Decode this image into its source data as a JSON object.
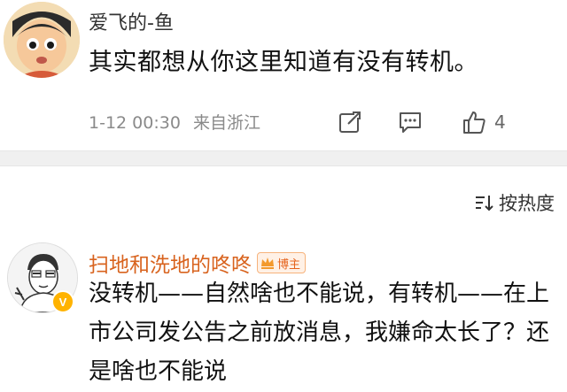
{
  "comment1": {
    "username": "爱飞的-鱼",
    "text": "其实都想从你这里知道有没有转机。",
    "timestamp": "1-12 00:30",
    "source": "来自浙江",
    "like_count": "4",
    "icons": [
      "share-icon",
      "comment-icon",
      "like-icon"
    ]
  },
  "sort": {
    "label": "按热度",
    "icon": "sort-icon"
  },
  "comment2": {
    "username": "扫地和洗地的咚咚",
    "badge_label": "博主",
    "verified_mark": "V",
    "text": "没转机——自然啥也不能说，有转机——在上市公司发公告之前放消息，我嫌命太长了？还是啥也不能说"
  },
  "colors": {
    "username_highlight": "#d8631e",
    "meta_gray": "#8a8a8a",
    "divider": "#f0f0f0"
  }
}
